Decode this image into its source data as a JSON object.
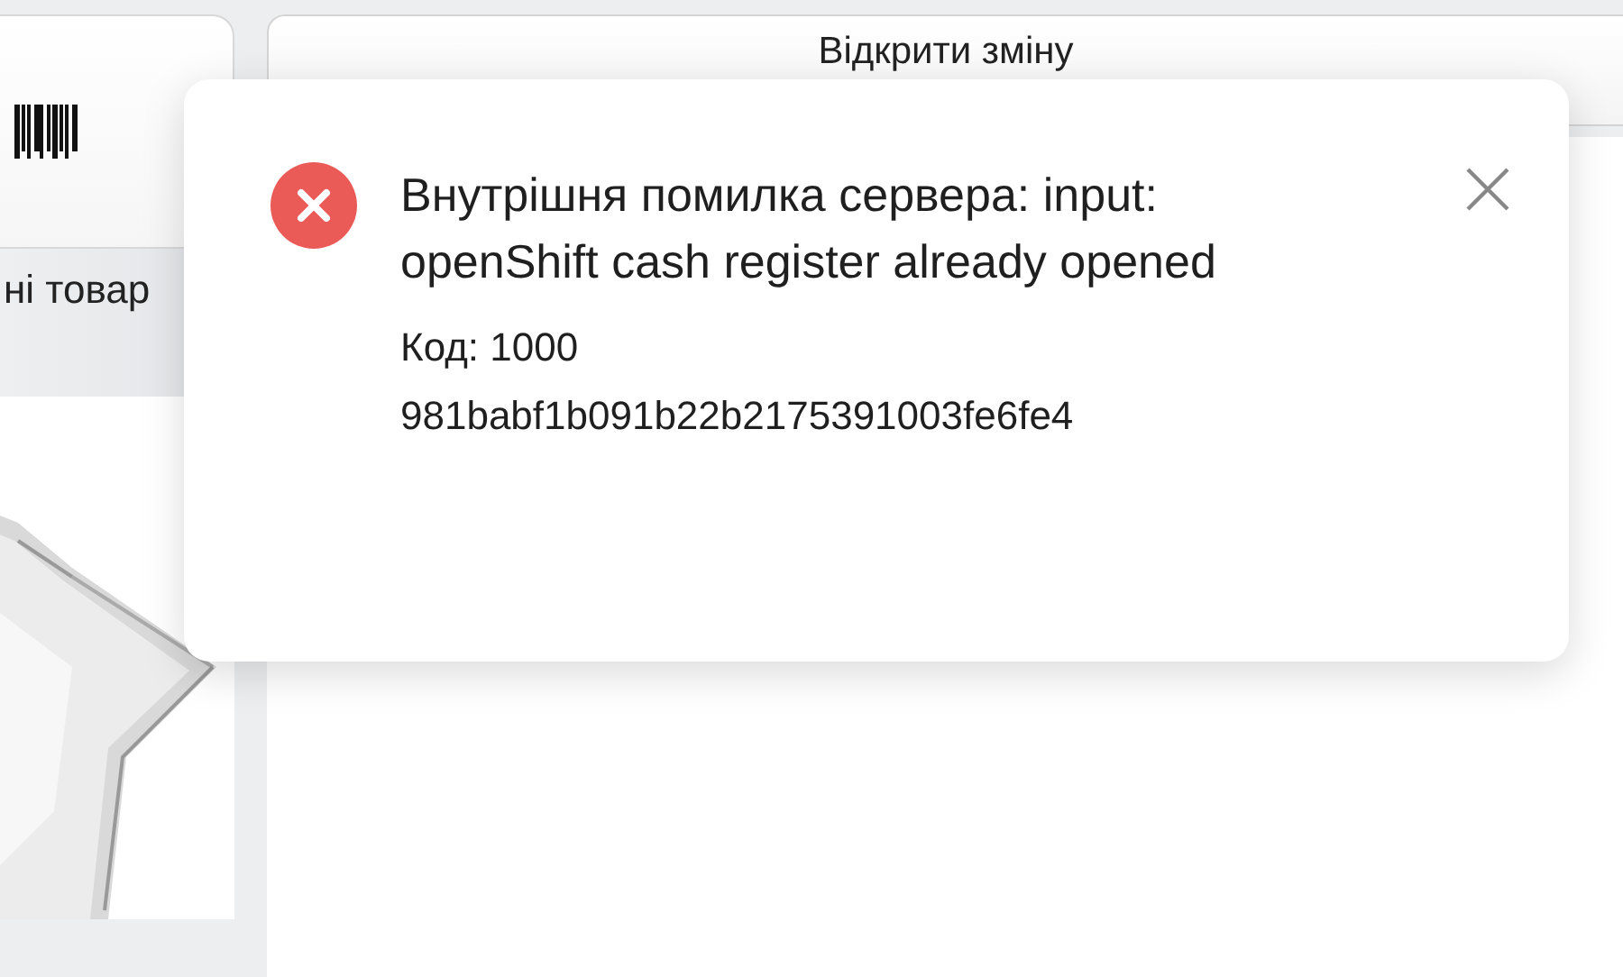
{
  "sidebar": {
    "category_label": "ні товар"
  },
  "open_shift_button": {
    "label": "Відкрити зміну"
  },
  "toast": {
    "kind": "error",
    "message": "Внутрішня помилка сервера: input: openShift cash register already opened",
    "code": "Код: 1000",
    "trace_id": "981babf1b091b22b2175391003fe6fe4"
  }
}
